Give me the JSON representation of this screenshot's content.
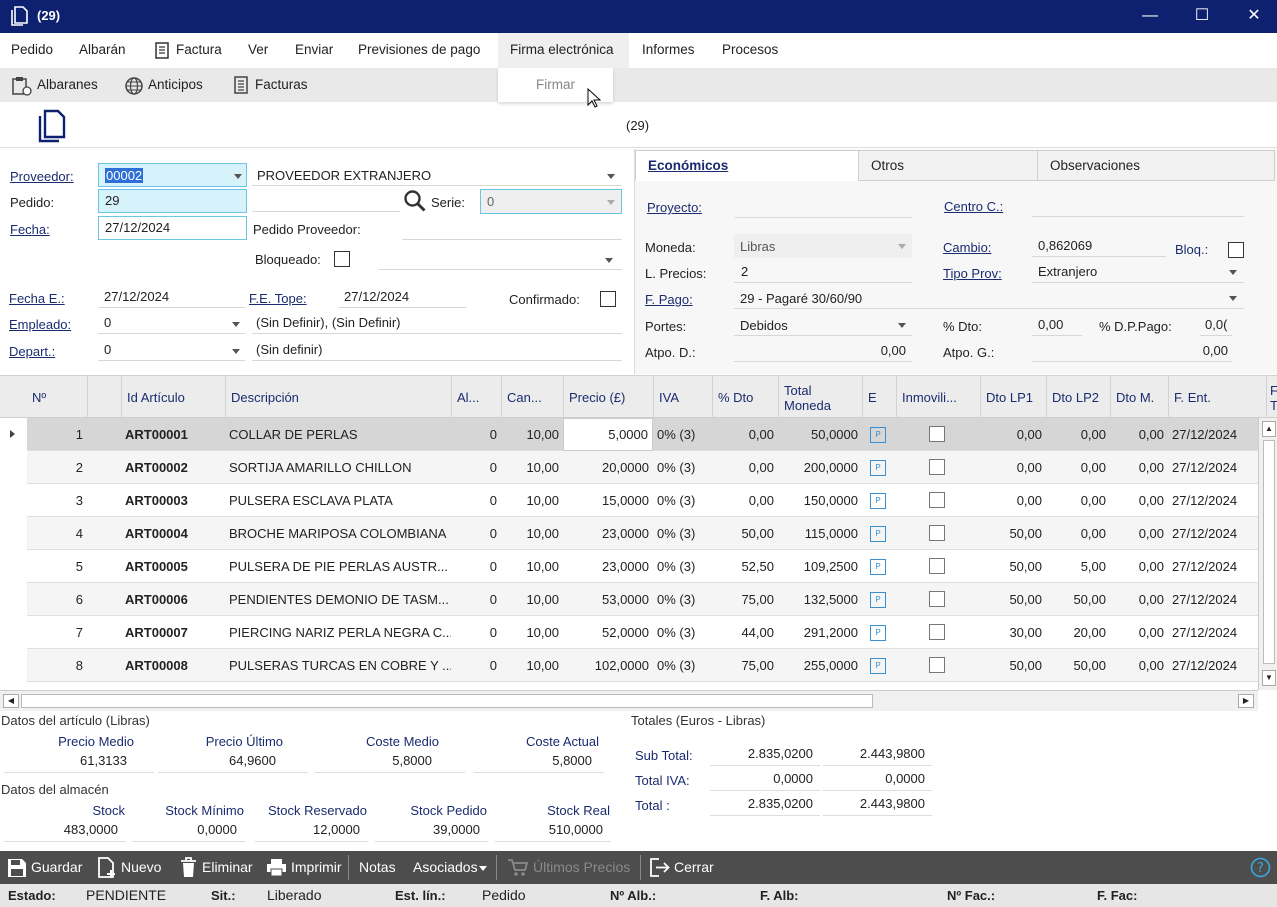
{
  "window": {
    "title": "(29)"
  },
  "menu": [
    "Pedido",
    "Albarán",
    "Factura",
    "Ver",
    "Enviar",
    "Previsiones de pago",
    "Firma electrónica",
    "Informes",
    "Procesos"
  ],
  "submenu": [
    "Albaranes",
    "Anticipos",
    "Facturas"
  ],
  "dropdown": {
    "item": "Firmar"
  },
  "doc_header": {
    "number": "(29)"
  },
  "form": {
    "proveedor_label": "Proveedor:",
    "proveedor_code": "00002",
    "proveedor_name": "PROVEEDOR EXTRANJERO",
    "pedido_label": "Pedido:",
    "pedido_value": "29",
    "serie_label": "Serie:",
    "serie_value": "0",
    "fecha_label": "Fecha:",
    "fecha_value": "27/12/2024",
    "pedido_prov_label": "Pedido Proveedor:",
    "bloqueado_label": "Bloqueado:",
    "fecha_e_label": "Fecha E.:",
    "fecha_e_value": "27/12/2024",
    "fe_tope_label": "F.E. Tope:",
    "fe_tope_value": "27/12/2024",
    "confirmado_label": "Confirmado:",
    "empleado_label": "Empleado:",
    "empleado_value": "0",
    "empleado_desc": "(Sin Definir), (Sin Definir)",
    "depart_label": "Depart.:",
    "depart_value": "0",
    "depart_desc": "(Sin definir)"
  },
  "tabs": [
    "Económicos",
    "Otros",
    "Observaciones"
  ],
  "economicos": {
    "proyecto_label": "Proyecto:",
    "centro_label": "Centro C.:",
    "moneda_label": "Moneda:",
    "moneda_value": "Libras",
    "cambio_label": "Cambio:",
    "cambio_value": "0,862069",
    "bloq_label": "Bloq.:",
    "lprecios_label": "L. Precios:",
    "lprecios_value": "2",
    "tipoprov_label": "Tipo Prov:",
    "tipoprov_value": "Extranjero",
    "fpago_label": "F. Pago:",
    "fpago_value": "29 - Pagaré 30/60/90",
    "portes_label": "Portes:",
    "portes_value": "Debidos",
    "dto_label": "% Dto:",
    "dto_value": "0,00",
    "dpago_label": "% D.P.Pago:",
    "dpago_value": "0,0(",
    "atpod_label": "Atpo. D.:",
    "atpod_value": "0,00",
    "atpog_label": "Atpo. G.:",
    "atpog_value": "0,00"
  },
  "grid": {
    "headers": [
      "Nº",
      "",
      "Id Artículo",
      "Descripción",
      "Al...",
      "Can...",
      "Precio (£)",
      "IVA",
      "% Dto",
      "Total Moneda",
      "E",
      "Inmovili...",
      "Dto LP1",
      "Dto LP2",
      "Dto M.",
      "F. Ent.",
      "F T"
    ],
    "rows": [
      {
        "n": "1",
        "id": "ART00001",
        "desc": "COLLAR DE PERLAS",
        "al": "0",
        "can": "10,00",
        "precio": "5,0000",
        "iva": "0% (3)",
        "dto": "0,00",
        "total": "50,0000",
        "lp1": "0,00",
        "lp2": "0,00",
        "m": "0,00",
        "fent": "27/12/2024"
      },
      {
        "n": "2",
        "id": "ART00002",
        "desc": "SORTIJA AMARILLO CHILLON",
        "al": "0",
        "can": "10,00",
        "precio": "20,0000",
        "iva": "0% (3)",
        "dto": "0,00",
        "total": "200,0000",
        "lp1": "0,00",
        "lp2": "0,00",
        "m": "0,00",
        "fent": "27/12/2024"
      },
      {
        "n": "3",
        "id": "ART00003",
        "desc": "PULSERA ESCLAVA PLATA",
        "al": "0",
        "can": "10,00",
        "precio": "15,0000",
        "iva": "0% (3)",
        "dto": "0,00",
        "total": "150,0000",
        "lp1": "0,00",
        "lp2": "0,00",
        "m": "0,00",
        "fent": "27/12/2024"
      },
      {
        "n": "4",
        "id": "ART00004",
        "desc": "BROCHE MARIPOSA COLOMBIANA",
        "al": "0",
        "can": "10,00",
        "precio": "23,0000",
        "iva": "0% (3)",
        "dto": "50,00",
        "total": "115,0000",
        "lp1": "50,00",
        "lp2": "0,00",
        "m": "0,00",
        "fent": "27/12/2024"
      },
      {
        "n": "5",
        "id": "ART00005",
        "desc": "PULSERA DE PIE PERLAS AUSTR...",
        "al": "0",
        "can": "10,00",
        "precio": "23,0000",
        "iva": "0% (3)",
        "dto": "52,50",
        "total": "109,2500",
        "lp1": "50,00",
        "lp2": "5,00",
        "m": "0,00",
        "fent": "27/12/2024"
      },
      {
        "n": "6",
        "id": "ART00006",
        "desc": "PENDIENTES DEMONIO DE TASM...",
        "al": "0",
        "can": "10,00",
        "precio": "53,0000",
        "iva": "0% (3)",
        "dto": "75,00",
        "total": "132,5000",
        "lp1": "50,00",
        "lp2": "50,00",
        "m": "0,00",
        "fent": "27/12/2024"
      },
      {
        "n": "7",
        "id": "ART00007",
        "desc": "PIERCING NARIZ PERLA NEGRA C...",
        "al": "0",
        "can": "10,00",
        "precio": "52,0000",
        "iva": "0% (3)",
        "dto": "44,00",
        "total": "291,2000",
        "lp1": "30,00",
        "lp2": "20,00",
        "m": "0,00",
        "fent": "27/12/2024"
      },
      {
        "n": "8",
        "id": "ART00008",
        "desc": "PULSERAS TURCAS EN COBRE Y ...",
        "al": "0",
        "can": "10,00",
        "precio": "102,0000",
        "iva": "0% (3)",
        "dto": "75,00",
        "total": "255,0000",
        "lp1": "50,00",
        "lp2": "50,00",
        "m": "0,00",
        "fent": "27/12/2024"
      }
    ]
  },
  "article_data": {
    "title": "Datos del artículo (Libras)",
    "items": [
      {
        "label": "Precio Medio",
        "value": "61,3133"
      },
      {
        "label": "Precio Último",
        "value": "64,9600"
      },
      {
        "label": "Coste Medio",
        "value": "5,8000"
      },
      {
        "label": "Coste Actual",
        "value": "5,8000"
      }
    ]
  },
  "stock_data": {
    "title": "Datos del almacén",
    "items": [
      {
        "label": "Stock",
        "value": "483,0000"
      },
      {
        "label": "Stock Mínimo",
        "value": "0,0000"
      },
      {
        "label": "Stock Reservado",
        "value": "12,0000"
      },
      {
        "label": "Stock Pedido",
        "value": "39,0000"
      },
      {
        "label": "Stock Real",
        "value": "510,0000"
      }
    ]
  },
  "totals": {
    "title": "Totales (Euros - Libras)",
    "rows": [
      {
        "label": "Sub Total:",
        "eur": "2.835,0200",
        "gbp": "2.443,9800"
      },
      {
        "label": "Total IVA:",
        "eur": "0,0000",
        "gbp": "0,0000"
      },
      {
        "label": "Total :",
        "eur": "2.835,0200",
        "gbp": "2.443,9800"
      }
    ]
  },
  "toolbar": {
    "guardar": "Guardar",
    "nuevo": "Nuevo",
    "eliminar": "Eliminar",
    "imprimir": "Imprimir",
    "notas": "Notas",
    "asociados": "Asociados",
    "ultimos": "Últimos Precios",
    "cerrar": "Cerrar"
  },
  "status": {
    "estado_label": "Estado:",
    "estado_value": "PENDIENTE",
    "sit_label": "Sit.:",
    "sit_value": "Liberado",
    "estlin_label": "Est. lín.:",
    "estlin_value": "Pedido",
    "nalb_label": "Nº Alb.:",
    "falb_label": "F. Alb:",
    "nfac_label": "Nº Fac.:",
    "ffac_label": "F. Fac:"
  }
}
